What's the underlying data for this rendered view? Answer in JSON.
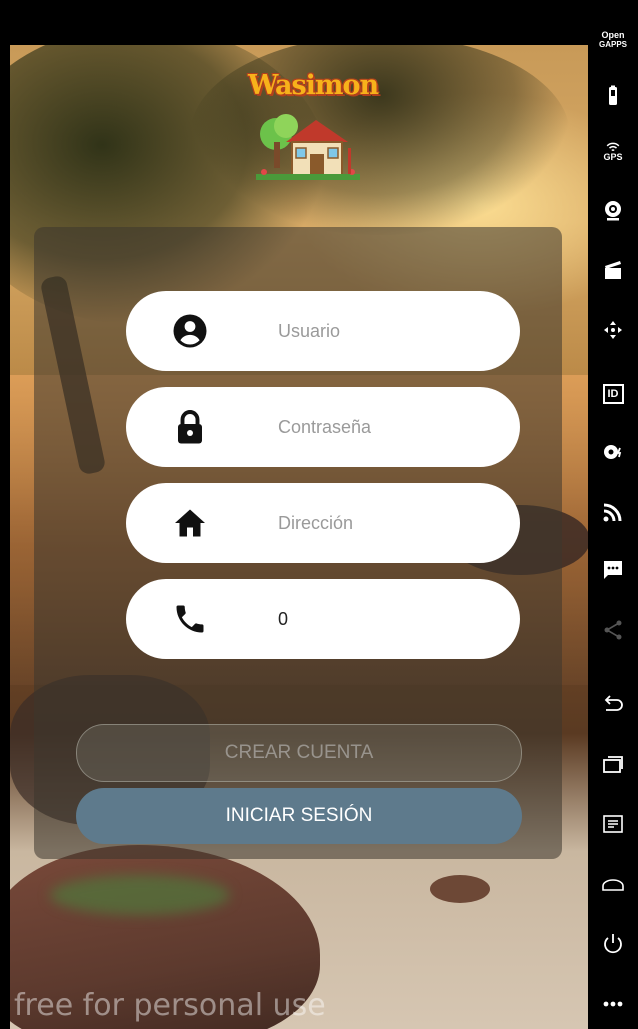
{
  "app": {
    "logo_text": "Wasimon"
  },
  "form": {
    "username_placeholder": "Usuario",
    "password_placeholder": "Contraseña",
    "address_placeholder": "Dirección",
    "phone_value": "0"
  },
  "buttons": {
    "create_account": "CREAR CUENTA",
    "login": "INICIAR SESIÓN"
  },
  "background": {
    "watermark": "free for personal use"
  },
  "sidebar": {
    "open_gapps_label_1": "Open",
    "open_gapps_label_2": "GAPPS",
    "gps_label": "GPS",
    "id_label": "ID",
    "icons": [
      "open-gapps-icon",
      "battery-icon",
      "gps-icon",
      "camera-icon",
      "media-icon",
      "dpad-icon",
      "id-icon",
      "record-icon",
      "cast-icon",
      "sms-icon",
      "share-icon",
      "back-icon",
      "recent-apps-icon",
      "menu-icon",
      "home-icon",
      "power-icon",
      "more-icon"
    ]
  },
  "colors": {
    "login_button": "#5e7a8c",
    "logo_text": "#f7b21b",
    "card_overlay": "rgba(60,55,45,0.55)"
  }
}
